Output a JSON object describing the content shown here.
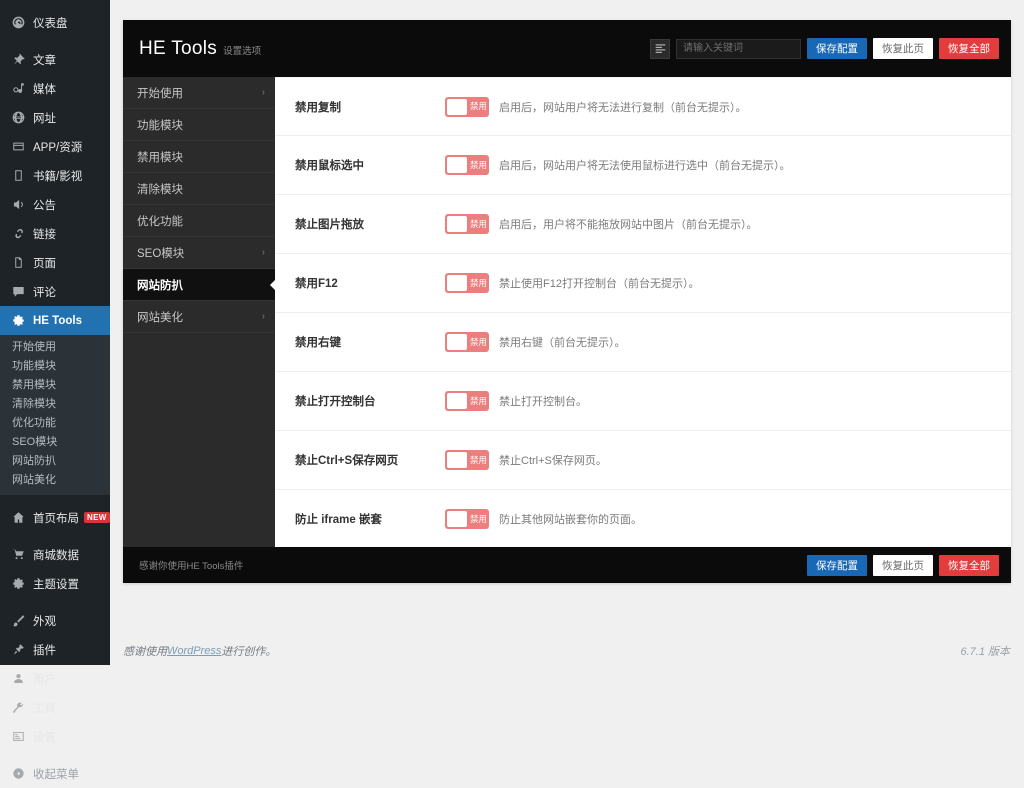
{
  "admin_sidebar": {
    "items": [
      {
        "label": "仪表盘",
        "icon": "dashboard-icon",
        "active": false
      },
      {
        "label": "文章",
        "icon": "pin-icon",
        "active": false
      },
      {
        "label": "媒体",
        "icon": "media-icon",
        "active": false
      },
      {
        "label": "网址",
        "icon": "globe-icon",
        "active": false
      },
      {
        "label": "APP/资源",
        "icon": "app-icon",
        "active": false
      },
      {
        "label": "书籍/影视",
        "icon": "book-icon",
        "active": false
      },
      {
        "label": "公告",
        "icon": "megaphone-icon",
        "active": false
      },
      {
        "label": "链接",
        "icon": "link-icon",
        "active": false
      },
      {
        "label": "页面",
        "icon": "page-icon",
        "active": false
      },
      {
        "label": "评论",
        "icon": "comment-icon",
        "active": false
      },
      {
        "label": "HE Tools",
        "icon": "gear-icon",
        "active": true
      }
    ],
    "submenu": [
      "开始使用",
      "功能模块",
      "禁用模块",
      "清除模块",
      "优化功能",
      "SEO模块",
      "网站防扒",
      "网站美化"
    ],
    "items_after": [
      {
        "label": "首页布局",
        "icon": "home-icon",
        "badge": "NEW"
      },
      {
        "label": "商城数据",
        "icon": "cart-icon",
        "badge": ""
      },
      {
        "label": "主题设置",
        "icon": "gear-icon",
        "badge": ""
      },
      {
        "label": "外观",
        "icon": "brush-icon",
        "badge": ""
      },
      {
        "label": "插件",
        "icon": "plugin-icon",
        "badge": ""
      },
      {
        "label": "用户",
        "icon": "user-icon",
        "badge": ""
      },
      {
        "label": "工具",
        "icon": "wrench-icon",
        "badge": ""
      },
      {
        "label": "设置",
        "icon": "settings-icon",
        "badge": ""
      },
      {
        "label": "收起菜单",
        "icon": "collapse-icon",
        "badge": ""
      }
    ]
  },
  "header": {
    "title": "HE Tools",
    "subtitle": "设置选项",
    "menu_icon": "list-icon",
    "search_placeholder": "请输入关键词",
    "search_value": "",
    "save_label": "保存配置",
    "restore_page_label": "恢复此页",
    "restore_all_label": "恢复全部"
  },
  "panel_nav": [
    {
      "label": "开始使用",
      "caret": "›",
      "active": false
    },
    {
      "label": "功能模块",
      "caret": "",
      "active": false
    },
    {
      "label": "禁用模块",
      "caret": "",
      "active": false
    },
    {
      "label": "清除模块",
      "caret": "",
      "active": false
    },
    {
      "label": "优化功能",
      "caret": "",
      "active": false
    },
    {
      "label": "SEO模块",
      "caret": "›",
      "active": false
    },
    {
      "label": "网站防扒",
      "caret": "",
      "active": true
    },
    {
      "label": "网站美化",
      "caret": "›",
      "active": false
    }
  ],
  "settings": [
    {
      "label": "禁用复制",
      "toggle_label": "禁用",
      "toggle_on": false,
      "desc": "启用后，网站用户将无法进行复制（前台无提示）。"
    },
    {
      "label": "禁用鼠标选中",
      "toggle_label": "禁用",
      "toggle_on": false,
      "desc": "启用后，网站用户将无法使用鼠标进行选中（前台无提示）。"
    },
    {
      "label": "禁止图片拖放",
      "toggle_label": "禁用",
      "toggle_on": false,
      "desc": "启用后，用户将不能拖放网站中图片（前台无提示）。"
    },
    {
      "label": "禁用F12",
      "toggle_label": "禁用",
      "toggle_on": false,
      "desc": "禁止使用F12打开控制台（前台无提示）。"
    },
    {
      "label": "禁用右键",
      "toggle_label": "禁用",
      "toggle_on": false,
      "desc": "禁用右键（前台无提示）。"
    },
    {
      "label": "禁止打开控制台",
      "toggle_label": "禁用",
      "toggle_on": false,
      "desc": "禁止打开控制台。"
    },
    {
      "label": "禁止Ctrl+S保存网页",
      "toggle_label": "禁用",
      "toggle_on": false,
      "desc": "禁止Ctrl+S保存网页。"
    },
    {
      "label": "防止 iframe 嵌套",
      "toggle_label": "禁用",
      "toggle_on": false,
      "desc": "防止其他网站嵌套你的页面。"
    }
  ],
  "panel_footer": {
    "note": "感谢你使用HE Tools插件",
    "save_label": "保存配置",
    "restore_page_label": "恢复此页",
    "restore_all_label": "恢复全部"
  },
  "wp_footer": {
    "thanks_prefix": "感谢使用 ",
    "link": "WordPress",
    "thanks_suffix": " 进行创作。",
    "version": "6.7.1 版本"
  },
  "colors": {
    "accent_blue": "#2271b1",
    "toggle_off": "#ec7e7e",
    "danger_red": "#e23c3c",
    "sidebar_bg": "#1d2327",
    "panel_dark": "#0b0b0b"
  }
}
